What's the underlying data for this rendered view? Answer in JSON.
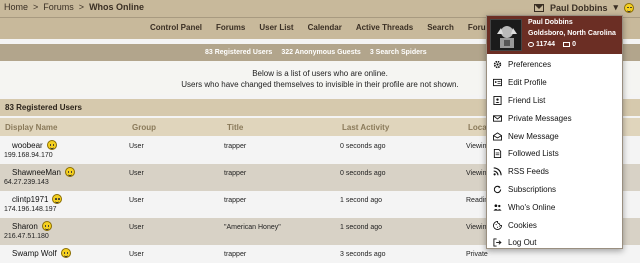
{
  "breadcrumb": {
    "home": "Home",
    "sep": ">",
    "forums": "Forums",
    "current": "Whos Online"
  },
  "userbar": {
    "username": "Paul Dobbins"
  },
  "nav": [
    "Control Panel",
    "Forums",
    "User List",
    "Calendar",
    "Active Threads",
    "Search",
    "Forum Help"
  ],
  "stats": [
    "83 Registered Users",
    "322 Anonymous Guests",
    "3 Search Spiders"
  ],
  "notice": {
    "line1": "Below is a list of users who are online.",
    "line2": "Users who have changed themselves to invisible in their profile are not shown."
  },
  "section": {
    "title": "83 Registered Users"
  },
  "columns": {
    "name": "Display Name",
    "group": "Group",
    "title": "Title",
    "activity": "Last Activity",
    "location": "Loca"
  },
  "rows": [
    {
      "name": "woobear",
      "ip": "199.168.94.170",
      "group": "User",
      "title": "trapper",
      "activity": "0 seconds ago",
      "location": "Viewin"
    },
    {
      "name": "ShawneeMan",
      "ip": "64.27.239.143",
      "group": "User",
      "title": "trapper",
      "activity": "0 seconds ago",
      "location": "Viewin"
    },
    {
      "name": "clintp1971",
      "ip": "174.196.148.197",
      "group": "User",
      "title": "trapper",
      "activity": "1 second ago",
      "location": "Readin"
    },
    {
      "name": "Sharon",
      "ip": "216.47.51.180",
      "group": "User",
      "title": "\"American Honey\"",
      "activity": "1 second ago",
      "location": "Viewin"
    },
    {
      "name": "Swamp Wolf",
      "ip": "",
      "group": "User",
      "title": "trapper",
      "activity": "3 seconds ago",
      "location": "Private"
    }
  ],
  "dropdown": {
    "name": "Paul Dobbins",
    "location": "Goldsboro, North Carolina",
    "posts": "11744",
    "messages": "0",
    "items": [
      {
        "label": "Preferences",
        "icon": "gear-icon"
      },
      {
        "label": "Edit Profile",
        "icon": "id-card-icon"
      },
      {
        "label": "Friend List",
        "icon": "address-book-icon"
      },
      {
        "label": "Private Messages",
        "icon": "envelope-icon"
      },
      {
        "label": "New Message",
        "icon": "envelope-open-icon"
      },
      {
        "label": "Followed Lists",
        "icon": "document-icon"
      },
      {
        "label": "RSS Feeds",
        "icon": "rss-icon"
      },
      {
        "label": "Subscriptions",
        "icon": "refresh-icon"
      },
      {
        "label": "Who's Online",
        "icon": "users-icon"
      },
      {
        "label": "Cookies",
        "icon": "cookie-icon"
      },
      {
        "label": "Log Out",
        "icon": "logout-icon"
      }
    ]
  },
  "colors": {
    "bar": "#c8b99b",
    "stat_bar": "#b2a58c",
    "dropdown_head": "#6b2e24",
    "row_alt": "#d8d2c6"
  }
}
